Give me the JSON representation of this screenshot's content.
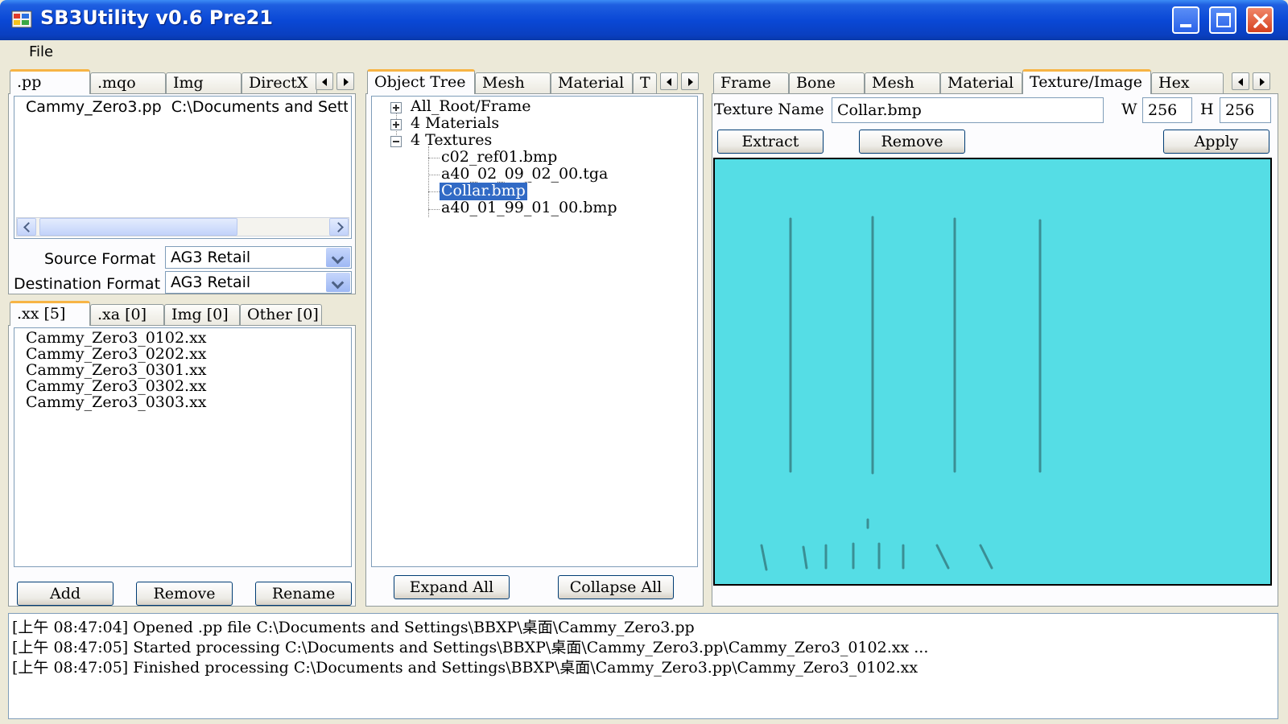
{
  "window": {
    "title": "SB3Utility v0.6 Pre21"
  },
  "menu": {
    "file": "File"
  },
  "left_top_tabs": [
    ".pp",
    ".mqo",
    "Img",
    "DirectX"
  ],
  "pp_list": [
    {
      "name": "Cammy_Zero3.pp",
      "path": "C:\\Documents and Sett"
    }
  ],
  "formats": {
    "source_label": "Source Format",
    "source_value": "AG3 Retail",
    "dest_label": "Destination Format",
    "dest_value": "AG3 Retail"
  },
  "left_bottom_tabs": [
    ".xx [5]",
    ".xa [0]",
    "Img [0]",
    "Other [0]"
  ],
  "xx_files": [
    "Cammy_Zero3_0102.xx",
    "Cammy_Zero3_0202.xx",
    "Cammy_Zero3_0301.xx",
    "Cammy_Zero3_0302.xx",
    "Cammy_Zero3_0303.xx"
  ],
  "left_buttons": {
    "add": "Add",
    "remove": "Remove",
    "rename": "Rename"
  },
  "middle_tabs": [
    "Object Tree",
    "Mesh",
    "Material",
    "T"
  ],
  "tree": {
    "root": "All_Root/Frame",
    "materials": "4 Materials",
    "textures": "4 Textures",
    "texture_items": [
      "c02_ref01.bmp",
      "a40_02_09_02_00.tga",
      "Collar.bmp",
      "a40_01_99_01_00.bmp"
    ],
    "selected_index": 2
  },
  "middle_buttons": {
    "expand": "Expand All",
    "collapse": "Collapse All"
  },
  "right_tabs": [
    "Frame",
    "Bone",
    "Mesh",
    "Material",
    "Texture/Image",
    "Hex"
  ],
  "texture": {
    "name_label": "Texture Name",
    "name_value": "Collar.bmp",
    "w_label": "W",
    "w_value": "256",
    "h_label": "H",
    "h_value": "256",
    "extract": "Extract",
    "remove": "Remove",
    "apply": "Apply",
    "image_bg_color": "#55dde5"
  },
  "log": [
    "[上午 08:47:04] Opened .pp file C:\\Documents and Settings\\BBXP\\桌面\\Cammy_Zero3.pp",
    "[上午 08:47:05] Started processing C:\\Documents and Settings\\BBXP\\桌面\\Cammy_Zero3.pp\\Cammy_Zero3_0102.xx ...",
    "[上午 08:47:05] Finished processing C:\\Documents and Settings\\BBXP\\桌面\\Cammy_Zero3.pp\\Cammy_Zero3_0102.xx"
  ],
  "accent_colors": {
    "titlebar": "#0a48d6",
    "selection": "#316ac5",
    "tab_highlight": "#f7b445"
  }
}
